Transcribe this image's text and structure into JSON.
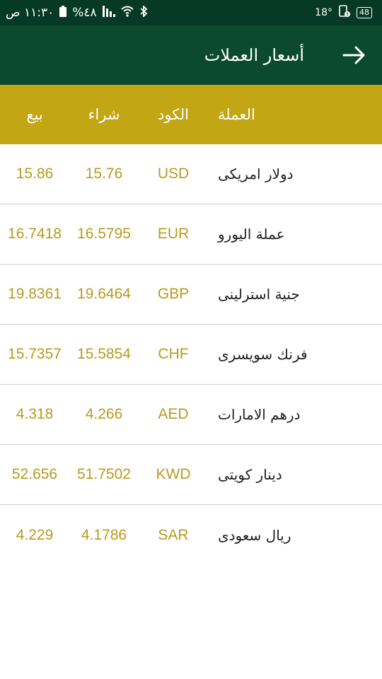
{
  "status_bar": {
    "time": "١١:٣٠ ص",
    "battery_percent": "%٤٨",
    "temperature": "18°",
    "battery_box": "48"
  },
  "app_bar": {
    "title": "أسعار العملات",
    "back_icon": "arrow-right-icon"
  },
  "table": {
    "headers": {
      "name": "العملة",
      "code": "الكود",
      "buy": "شراء",
      "sell": "بيع"
    },
    "rows": [
      {
        "name": "دولار امريكى",
        "code": "USD",
        "buy": "15.76",
        "sell": "15.86"
      },
      {
        "name": "عملة اليورو",
        "code": "EUR",
        "buy": "16.5795",
        "sell": "16.7418"
      },
      {
        "name": "جنية استرلينى",
        "code": "GBP",
        "buy": "19.6464",
        "sell": "19.8361"
      },
      {
        "name": "فرنك سويسرى",
        "code": "CHF",
        "buy": "15.5854",
        "sell": "15.7357"
      },
      {
        "name": "درهم الامارات",
        "code": "AED",
        "buy": "4.266",
        "sell": "4.318"
      },
      {
        "name": "دينار كويتى",
        "code": "KWD",
        "buy": "51.7502",
        "sell": "52.656"
      },
      {
        "name": "ريال سعودى",
        "code": "SAR",
        "buy": "4.1786",
        "sell": "4.229"
      }
    ]
  },
  "colors": {
    "status_bar": "#073a26",
    "app_bar": "#0b4a2f",
    "header_row": "#c2a614",
    "value_text": "#b89a1e"
  }
}
